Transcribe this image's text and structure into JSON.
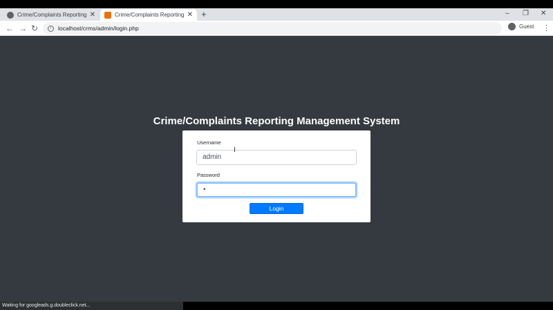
{
  "browser": {
    "tabs": [
      {
        "title": "Crime/Complaints Reporting Ma",
        "close": "✕"
      },
      {
        "title": "Crime/Complaints Reporting Ma",
        "close": "✕"
      }
    ],
    "new_tab": "+",
    "window_controls": {
      "minimize": "–",
      "restore": "❐",
      "close": "✕"
    },
    "nav": {
      "back": "←",
      "forward": "→",
      "reload": "↻"
    },
    "url": "localhost/crms/admin/login.php",
    "profile_label": "Guest",
    "menu": "⋮"
  },
  "page": {
    "title": "Crime/Complaints Reporting Management System",
    "form": {
      "username_label": "Username",
      "username_value": "admin",
      "password_label": "Password",
      "password_value": "•",
      "login_label": "Login"
    }
  },
  "status_text": "Waiting for googleads.g.doubleclick.net...",
  "colors": {
    "page_bg": "#343a40",
    "primary": "#007bff",
    "focus_border": "#80bdff"
  }
}
